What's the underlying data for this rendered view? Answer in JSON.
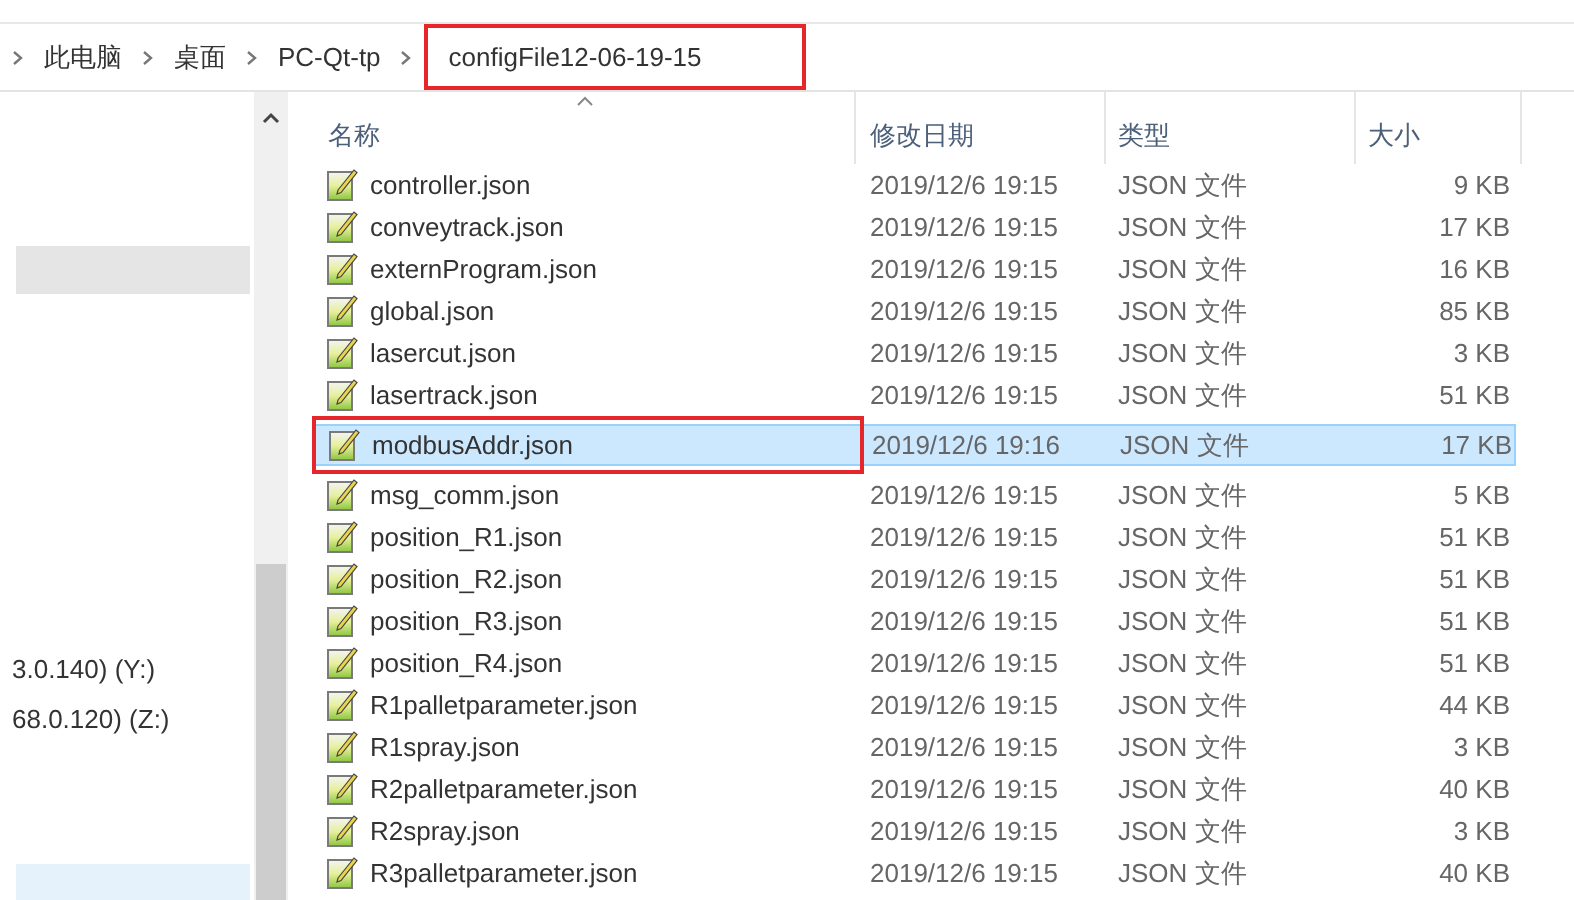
{
  "breadcrumb": [
    {
      "label": "此电脑",
      "highlighted": false
    },
    {
      "label": "桌面",
      "highlighted": false
    },
    {
      "label": "PC-Qt-tp",
      "highlighted": false
    },
    {
      "label": "configFile12-06-19-15",
      "highlighted": true
    }
  ],
  "navigation": [
    {
      "label": "3.0.140) (Y:)",
      "selected": false
    },
    {
      "label": "68.0.120) (Z:)",
      "selected": false
    }
  ],
  "columns": [
    "名称",
    "修改日期",
    "类型",
    "大小"
  ],
  "rows": [
    {
      "name": "controller.json",
      "modified": "2019/12/6 19:15",
      "type": "JSON 文件",
      "size": "9 KB",
      "selected": false,
      "highlighted": false
    },
    {
      "name": "conveytrack.json",
      "modified": "2019/12/6 19:15",
      "type": "JSON 文件",
      "size": "17 KB",
      "selected": false,
      "highlighted": false
    },
    {
      "name": "externProgram.json",
      "modified": "2019/12/6 19:15",
      "type": "JSON 文件",
      "size": "16 KB",
      "selected": false,
      "highlighted": false
    },
    {
      "name": "global.json",
      "modified": "2019/12/6 19:15",
      "type": "JSON 文件",
      "size": "85 KB",
      "selected": false,
      "highlighted": false
    },
    {
      "name": "lasercut.json",
      "modified": "2019/12/6 19:15",
      "type": "JSON 文件",
      "size": "3 KB",
      "selected": false,
      "highlighted": false
    },
    {
      "name": "lasertrack.json",
      "modified": "2019/12/6 19:15",
      "type": "JSON 文件",
      "size": "51 KB",
      "selected": false,
      "highlighted": false
    },
    {
      "name": "modbusAddr.json",
      "modified": "2019/12/6 19:16",
      "type": "JSON 文件",
      "size": "17 KB",
      "selected": true,
      "highlighted": true
    },
    {
      "name": "msg_comm.json",
      "modified": "2019/12/6 19:15",
      "type": "JSON 文件",
      "size": "5 KB",
      "selected": false,
      "highlighted": false
    },
    {
      "name": "position_R1.json",
      "modified": "2019/12/6 19:15",
      "type": "JSON 文件",
      "size": "51 KB",
      "selected": false,
      "highlighted": false
    },
    {
      "name": "position_R2.json",
      "modified": "2019/12/6 19:15",
      "type": "JSON 文件",
      "size": "51 KB",
      "selected": false,
      "highlighted": false
    },
    {
      "name": "position_R3.json",
      "modified": "2019/12/6 19:15",
      "type": "JSON 文件",
      "size": "51 KB",
      "selected": false,
      "highlighted": false
    },
    {
      "name": "position_R4.json",
      "modified": "2019/12/6 19:15",
      "type": "JSON 文件",
      "size": "51 KB",
      "selected": false,
      "highlighted": false
    },
    {
      "name": "R1palletparameter.json",
      "modified": "2019/12/6 19:15",
      "type": "JSON 文件",
      "size": "44 KB",
      "selected": false,
      "highlighted": false
    },
    {
      "name": "R1spray.json",
      "modified": "2019/12/6 19:15",
      "type": "JSON 文件",
      "size": "3 KB",
      "selected": false,
      "highlighted": false
    },
    {
      "name": "R2palletparameter.json",
      "modified": "2019/12/6 19:15",
      "type": "JSON 文件",
      "size": "40 KB",
      "selected": false,
      "highlighted": false
    },
    {
      "name": "R2spray.json",
      "modified": "2019/12/6 19:15",
      "type": "JSON 文件",
      "size": "3 KB",
      "selected": false,
      "highlighted": false
    },
    {
      "name": "R3palletparameter.json",
      "modified": "2019/12/6 19:15",
      "type": "JSON 文件",
      "size": "40 KB",
      "selected": false,
      "highlighted": false
    }
  ]
}
